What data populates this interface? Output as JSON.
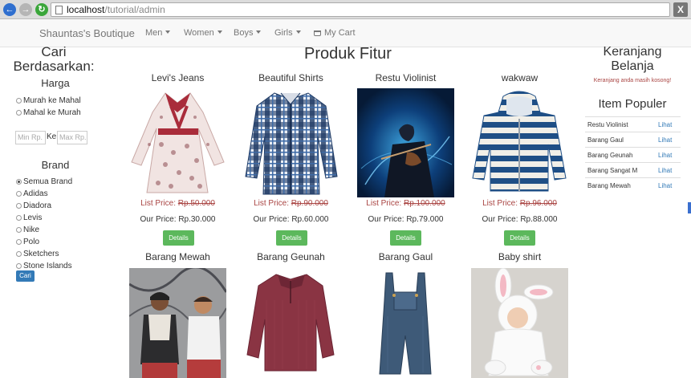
{
  "browser": {
    "url_host": "localhost",
    "url_path": "/tutorial/admin",
    "close_label": "X"
  },
  "navbar": {
    "brand": "Shauntas's Boutique",
    "items": [
      "Men",
      "Women",
      "Boys",
      "Girls"
    ],
    "cart_label": "My Cart"
  },
  "filter": {
    "title_line1": "Cari",
    "title_line2": "Berdasarkan:",
    "price_heading": "Harga",
    "price_options": [
      "Murah ke Mahal",
      "Mahal ke Murah"
    ],
    "min_placeholder": "Min Rp.",
    "between_label": "Ke",
    "max_placeholder": "Max Rp.",
    "brand_heading": "Brand",
    "brands": [
      "Semua Brand",
      "Adidas",
      "Diadora",
      "Levis",
      "Nike",
      "Polo",
      "Sketchers",
      "Stone Islands"
    ],
    "selected_brand": "Semua Brand",
    "search_button": "Cari"
  },
  "main": {
    "title": "Produk Fitur",
    "list_price_label": "List Price:",
    "our_price_label": "Our Price:",
    "details_label": "Details",
    "products": [
      {
        "name": "Levi's Jeans",
        "list_price": "Rp.50.000",
        "our_price": "Rp.30.000"
      },
      {
        "name": "Beautiful Shirts",
        "list_price": "Rp.90.000",
        "our_price": "Rp.60.000"
      },
      {
        "name": "Restu Violinist",
        "list_price": "Rp.100.000",
        "our_price": "Rp.79.000"
      },
      {
        "name": "wakwaw",
        "list_price": "Rp.96.000",
        "our_price": "Rp.88.000"
      },
      {
        "name": "Barang Mewah"
      },
      {
        "name": "Barang Geunah"
      },
      {
        "name": "Barang Gaul"
      },
      {
        "name": "Baby shirt"
      }
    ]
  },
  "cart": {
    "title_line1": "Keranjang",
    "title_line2": "Belanja",
    "empty_message": "Keranjang anda masih kosong!"
  },
  "popular": {
    "title": "Item Populer",
    "link_label": "Lihat",
    "items": [
      "Restu Violinist",
      "Barang Gaul",
      "Barang Geunah",
      "Barang Sangat M",
      "Barang Mewah"
    ]
  },
  "colors": {
    "details_button": "#5cb85c",
    "list_price": "#a94442",
    "link": "#337ab7",
    "cari_button": "#337ab7"
  }
}
